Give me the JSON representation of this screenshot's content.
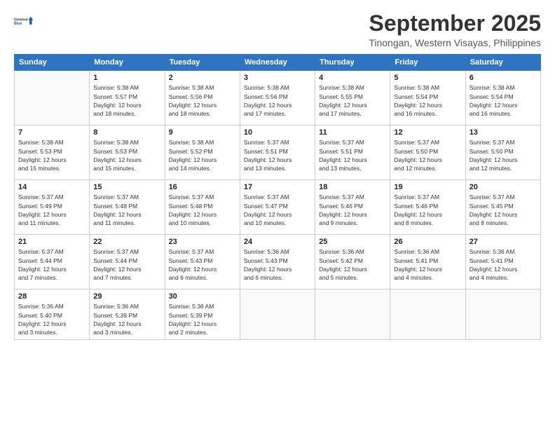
{
  "header": {
    "logo_line1": "General",
    "logo_line2": "Blue",
    "month": "September 2025",
    "location": "Tinongan, Western Visayas, Philippines"
  },
  "days_of_week": [
    "Sunday",
    "Monday",
    "Tuesday",
    "Wednesday",
    "Thursday",
    "Friday",
    "Saturday"
  ],
  "weeks": [
    [
      {
        "day": "",
        "info": ""
      },
      {
        "day": "1",
        "info": "Sunrise: 5:38 AM\nSunset: 5:57 PM\nDaylight: 12 hours\nand 18 minutes."
      },
      {
        "day": "2",
        "info": "Sunrise: 5:38 AM\nSunset: 5:56 PM\nDaylight: 12 hours\nand 18 minutes."
      },
      {
        "day": "3",
        "info": "Sunrise: 5:38 AM\nSunset: 5:56 PM\nDaylight: 12 hours\nand 17 minutes."
      },
      {
        "day": "4",
        "info": "Sunrise: 5:38 AM\nSunset: 5:55 PM\nDaylight: 12 hours\nand 17 minutes."
      },
      {
        "day": "5",
        "info": "Sunrise: 5:38 AM\nSunset: 5:54 PM\nDaylight: 12 hours\nand 16 minutes."
      },
      {
        "day": "6",
        "info": "Sunrise: 5:38 AM\nSunset: 5:54 PM\nDaylight: 12 hours\nand 16 minutes."
      }
    ],
    [
      {
        "day": "7",
        "info": "Sunrise: 5:38 AM\nSunset: 5:53 PM\nDaylight: 12 hours\nand 15 minutes."
      },
      {
        "day": "8",
        "info": "Sunrise: 5:38 AM\nSunset: 5:53 PM\nDaylight: 12 hours\nand 15 minutes."
      },
      {
        "day": "9",
        "info": "Sunrise: 5:38 AM\nSunset: 5:52 PM\nDaylight: 12 hours\nand 14 minutes."
      },
      {
        "day": "10",
        "info": "Sunrise: 5:37 AM\nSunset: 5:51 PM\nDaylight: 12 hours\nand 13 minutes."
      },
      {
        "day": "11",
        "info": "Sunrise: 5:37 AM\nSunset: 5:51 PM\nDaylight: 12 hours\nand 13 minutes."
      },
      {
        "day": "12",
        "info": "Sunrise: 5:37 AM\nSunset: 5:50 PM\nDaylight: 12 hours\nand 12 minutes."
      },
      {
        "day": "13",
        "info": "Sunrise: 5:37 AM\nSunset: 5:50 PM\nDaylight: 12 hours\nand 12 minutes."
      }
    ],
    [
      {
        "day": "14",
        "info": "Sunrise: 5:37 AM\nSunset: 5:49 PM\nDaylight: 12 hours\nand 11 minutes."
      },
      {
        "day": "15",
        "info": "Sunrise: 5:37 AM\nSunset: 5:48 PM\nDaylight: 12 hours\nand 11 minutes."
      },
      {
        "day": "16",
        "info": "Sunrise: 5:37 AM\nSunset: 5:48 PM\nDaylight: 12 hours\nand 10 minutes."
      },
      {
        "day": "17",
        "info": "Sunrise: 5:37 AM\nSunset: 5:47 PM\nDaylight: 12 hours\nand 10 minutes."
      },
      {
        "day": "18",
        "info": "Sunrise: 5:37 AM\nSunset: 5:46 PM\nDaylight: 12 hours\nand 9 minutes."
      },
      {
        "day": "19",
        "info": "Sunrise: 5:37 AM\nSunset: 5:46 PM\nDaylight: 12 hours\nand 8 minutes."
      },
      {
        "day": "20",
        "info": "Sunrise: 5:37 AM\nSunset: 5:45 PM\nDaylight: 12 hours\nand 8 minutes."
      }
    ],
    [
      {
        "day": "21",
        "info": "Sunrise: 5:37 AM\nSunset: 5:44 PM\nDaylight: 12 hours\nand 7 minutes."
      },
      {
        "day": "22",
        "info": "Sunrise: 5:37 AM\nSunset: 5:44 PM\nDaylight: 12 hours\nand 7 minutes."
      },
      {
        "day": "23",
        "info": "Sunrise: 5:37 AM\nSunset: 5:43 PM\nDaylight: 12 hours\nand 6 minutes."
      },
      {
        "day": "24",
        "info": "Sunrise: 5:36 AM\nSunset: 5:43 PM\nDaylight: 12 hours\nand 6 minutes."
      },
      {
        "day": "25",
        "info": "Sunrise: 5:36 AM\nSunset: 5:42 PM\nDaylight: 12 hours\nand 5 minutes."
      },
      {
        "day": "26",
        "info": "Sunrise: 5:36 AM\nSunset: 5:41 PM\nDaylight: 12 hours\nand 4 minutes."
      },
      {
        "day": "27",
        "info": "Sunrise: 5:36 AM\nSunset: 5:41 PM\nDaylight: 12 hours\nand 4 minutes."
      }
    ],
    [
      {
        "day": "28",
        "info": "Sunrise: 5:36 AM\nSunset: 5:40 PM\nDaylight: 12 hours\nand 3 minutes."
      },
      {
        "day": "29",
        "info": "Sunrise: 5:36 AM\nSunset: 5:39 PM\nDaylight: 12 hours\nand 3 minutes."
      },
      {
        "day": "30",
        "info": "Sunrise: 5:36 AM\nSunset: 5:39 PM\nDaylight: 12 hours\nand 2 minutes."
      },
      {
        "day": "",
        "info": ""
      },
      {
        "day": "",
        "info": ""
      },
      {
        "day": "",
        "info": ""
      },
      {
        "day": "",
        "info": ""
      }
    ]
  ]
}
